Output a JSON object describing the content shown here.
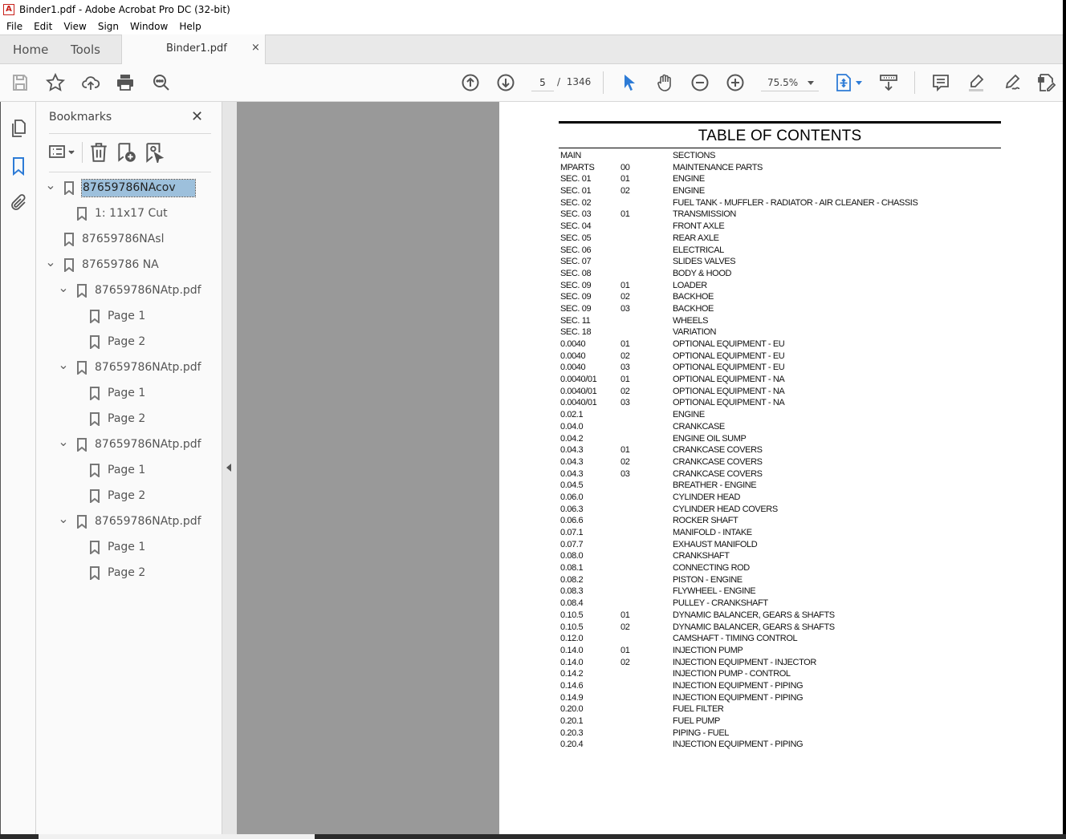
{
  "window": {
    "title": "Binder1.pdf - Adobe Acrobat Pro DC (32-bit)",
    "app_icon": "acrobat-icon"
  },
  "menu": [
    "File",
    "Edit",
    "View",
    "Sign",
    "Window",
    "Help"
  ],
  "tabs": {
    "home": "Home",
    "tools": "Tools",
    "document": "Binder1.pdf",
    "close_glyph": "×"
  },
  "toolbar": {
    "left_icons": [
      "save-icon",
      "bookmark-star-icon",
      "upload-cloud-icon",
      "print-icon",
      "search-zoom-icon"
    ],
    "current_page": "5",
    "page_separator": "/",
    "total_pages": "1346",
    "zoom_level": "75.5%",
    "right_icons": [
      "select-arrow-icon",
      "hand-icon",
      "zoom-out-icon",
      "zoom-in-icon",
      "fit-page-icon",
      "scroll-mode-icon",
      "comment-icon",
      "highlight-icon",
      "sign-icon",
      "edit-pdf-icon"
    ]
  },
  "bookmarks": {
    "title": "Bookmarks",
    "close_glyph": "✕",
    "items": [
      {
        "label": "87659786NAcov",
        "level": 0,
        "expanded": true,
        "selected": true
      },
      {
        "label": "1: 11x17 Cut",
        "level": 1,
        "expanded": null,
        "selected": false
      },
      {
        "label": "87659786NAsl",
        "level": 0,
        "expanded": null,
        "selected": false
      },
      {
        "label": "87659786 NA",
        "level": 0,
        "expanded": true,
        "selected": false
      },
      {
        "label": "87659786NAtp.pdf",
        "level": 1,
        "expanded": true,
        "selected": false
      },
      {
        "label": "Page 1",
        "level": 2,
        "expanded": null,
        "selected": false
      },
      {
        "label": "Page 2",
        "level": 2,
        "expanded": null,
        "selected": false
      },
      {
        "label": "87659786NAtp.pdf",
        "level": 1,
        "expanded": true,
        "selected": false
      },
      {
        "label": "Page 1",
        "level": 2,
        "expanded": null,
        "selected": false
      },
      {
        "label": "Page 2",
        "level": 2,
        "expanded": null,
        "selected": false
      },
      {
        "label": "87659786NAtp.pdf",
        "level": 1,
        "expanded": true,
        "selected": false
      },
      {
        "label": "Page 1",
        "level": 2,
        "expanded": null,
        "selected": false
      },
      {
        "label": "Page 2",
        "level": 2,
        "expanded": null,
        "selected": false
      },
      {
        "label": "87659786NAtp.pdf",
        "level": 1,
        "expanded": true,
        "selected": false
      },
      {
        "label": "Page 1",
        "level": 2,
        "expanded": null,
        "selected": false
      },
      {
        "label": "Page 2",
        "level": 2,
        "expanded": null,
        "selected": false
      }
    ]
  },
  "document": {
    "title": "TABLE OF CONTENTS",
    "rows": [
      [
        "MAIN",
        "",
        "SECTIONS"
      ],
      [
        "MPARTS",
        "00",
        "MAINTENANCE PARTS"
      ],
      [
        "SEC. 01",
        "01",
        "ENGINE"
      ],
      [
        "SEC. 01",
        "02",
        "ENGINE"
      ],
      [
        "SEC. 02",
        "",
        "FUEL TANK - MUFFLER - RADIATOR - AIR CLEANER - CHASSIS"
      ],
      [
        "SEC. 03",
        "01",
        "TRANSMISSION"
      ],
      [
        "SEC. 04",
        "",
        "FRONT AXLE"
      ],
      [
        "SEC. 05",
        "",
        "REAR AXLE"
      ],
      [
        "SEC. 06",
        "",
        "ELECTRICAL"
      ],
      [
        "SEC. 07",
        "",
        "SLIDES VALVES"
      ],
      [
        "SEC. 08",
        "",
        "BODY & HOOD"
      ],
      [
        "SEC. 09",
        "01",
        "LOADER"
      ],
      [
        "SEC. 09",
        "02",
        "BACKHOE"
      ],
      [
        "SEC. 09",
        "03",
        "BACKHOE"
      ],
      [
        "SEC. 11",
        "",
        "WHEELS"
      ],
      [
        "SEC. 18",
        "",
        "VARIATION"
      ],
      [
        "0.0040",
        "01",
        "OPTIONAL EQUIPMENT - EU"
      ],
      [
        "0.0040",
        "02",
        "OPTIONAL EQUIPMENT - EU"
      ],
      [
        "0.0040",
        "03",
        "OPTIONAL EQUIPMENT - EU"
      ],
      [
        "0.0040/01",
        "01",
        "OPTIONAL EQUIPMENT - NA"
      ],
      [
        "0.0040/01",
        "02",
        "OPTIONAL EQUIPMENT - NA"
      ],
      [
        "0.0040/01",
        "03",
        "OPTIONAL EQUIPMENT - NA"
      ],
      [
        "0.02.1",
        "",
        "ENGINE"
      ],
      [
        "0.04.0",
        "",
        "CRANKCASE"
      ],
      [
        "0.04.2",
        "",
        "ENGINE OIL SUMP"
      ],
      [
        "0.04.3",
        "01",
        "CRANKCASE COVERS"
      ],
      [
        "0.04.3",
        "02",
        "CRANKCASE COVERS"
      ],
      [
        "0.04.3",
        "03",
        "CRANKCASE COVERS"
      ],
      [
        "0.04.5",
        "",
        "BREATHER - ENGINE"
      ],
      [
        "0.06.0",
        "",
        "CYLINDER HEAD"
      ],
      [
        "0.06.3",
        "",
        "CYLINDER HEAD COVERS"
      ],
      [
        "0.06.6",
        "",
        "ROCKER SHAFT"
      ],
      [
        "0.07.1",
        "",
        "MANIFOLD - INTAKE"
      ],
      [
        "0.07.7",
        "",
        "EXHAUST MANIFOLD"
      ],
      [
        "0.08.0",
        "",
        "CRANKSHAFT"
      ],
      [
        "0.08.1",
        "",
        "CONNECTING ROD"
      ],
      [
        "0.08.2",
        "",
        "PISTON - ENGINE"
      ],
      [
        "0.08.3",
        "",
        "FLYWHEEL - ENGINE"
      ],
      [
        "0.08.4",
        "",
        "PULLEY - CRANKSHAFT"
      ],
      [
        "0.10.5",
        "01",
        "DYNAMIC BALANCER, GEARS & SHAFTS"
      ],
      [
        "0.10.5",
        "02",
        "DYNAMIC BALANCER, GEARS & SHAFTS"
      ],
      [
        "0.12.0",
        "",
        "CAMSHAFT - TIMING CONTROL"
      ],
      [
        "0.14.0",
        "01",
        "INJECTION PUMP"
      ],
      [
        "0.14.0",
        "02",
        "INJECTION EQUIPMENT - INJECTOR"
      ],
      [
        "0.14.2",
        "",
        "INJECTION PUMP - CONTROL"
      ],
      [
        "0.14.6",
        "",
        "INJECTION EQUIPMENT - PIPING"
      ],
      [
        "0.14.9",
        "",
        "INJECTION EQUIPMENT - PIPING"
      ],
      [
        "0.20.0",
        "",
        "FUEL FILTER"
      ],
      [
        "0.20.1",
        "",
        "FUEL PUMP"
      ],
      [
        "0.20.3",
        "",
        "PIPING - FUEL"
      ],
      [
        "0.20.4",
        "",
        "INJECTION EQUIPMENT - PIPING"
      ]
    ]
  },
  "colors": {
    "accent": "#2d7bd6",
    "selection": "#9dc0dc",
    "canvas_gray": "#999999"
  }
}
